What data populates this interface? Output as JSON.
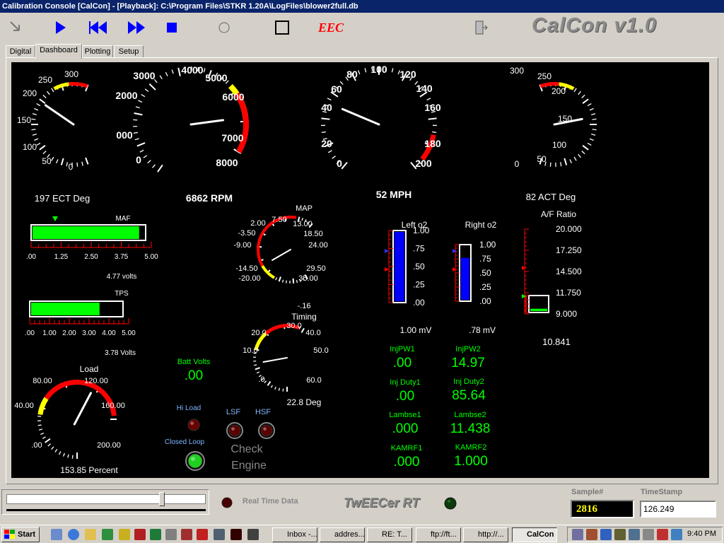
{
  "window": {
    "title": "Calibration Console [CalCon] - [Playback]: C:\\Program Files\\STKR 1.20A\\LogFiles\\blower2full.db"
  },
  "toolbar": {
    "brand": "CalCon v1.0",
    "eec_icon": "EEC"
  },
  "tabs": [
    {
      "label": "Digital"
    },
    {
      "label": "Dashboard"
    },
    {
      "label": "Plotting"
    },
    {
      "label": "Setup"
    }
  ],
  "gauges": {
    "ect": {
      "ticks": [
        "300",
        "250",
        "200",
        "150",
        "100",
        "50",
        "0"
      ],
      "readout": "197 ECT Deg",
      "value": 197
    },
    "rpm": {
      "ticks": [
        "8000",
        "7000",
        "6000",
        "5000",
        "4000",
        "3000",
        "2000",
        "000",
        "0"
      ],
      "readout": "6862 RPM",
      "value": 6862
    },
    "speed": {
      "ticks": [
        "0",
        "20",
        "40",
        "60",
        "80",
        "100",
        "120",
        "140",
        "160",
        "180",
        "200"
      ],
      "readout": "52 MPH",
      "value": 52
    },
    "act": {
      "ticks": [
        "300",
        "250",
        "200",
        "150",
        "100",
        "50",
        "0"
      ],
      "readout": "82 ACT Deg",
      "value": 82
    },
    "map": {
      "title": "MAP",
      "ticks": [
        "-20.00",
        "-14.50",
        "-9.00",
        "-3.50",
        "2.00",
        "7.50",
        "13.00",
        "18.50",
        "24.00",
        "29.50",
        "35.00"
      ],
      "value": -0.6
    },
    "timing": {
      "title": "Timing",
      "ticks": [
        ".0",
        "10.0",
        "20.0",
        "30.0",
        "40.0",
        "50.0",
        "60.0"
      ],
      "top_value": "-.16",
      "readout": "22.8 Deg",
      "value": 22.8
    },
    "load": {
      "title": "Load",
      "ticks": [
        ".00",
        "40.00",
        "80.00",
        "120.00",
        "160.00",
        "200.00"
      ],
      "readout": "153.85 Percent",
      "value": 153.85
    }
  },
  "bars": {
    "maf": {
      "title": "MAF",
      "ticks": [
        ".00",
        "1.25",
        "2.50",
        "3.75",
        "5.00"
      ],
      "readout": "4.77 volts",
      "value": 4.77,
      "max": 5.0
    },
    "tps": {
      "title": "TPS",
      "ticks": [
        ".00",
        "1.00",
        "2.00",
        "3.00",
        "4.00",
        "5.00"
      ],
      "readout": "3.78 Volts",
      "value": 3.78,
      "max": 5.0
    },
    "left_o2": {
      "title": "Left o2",
      "ticks": [
        "1.00",
        ".75",
        ".50",
        ".25",
        ".00"
      ],
      "readout": "1.00 mV",
      "value": 1.0,
      "max": 1.0
    },
    "right_o2": {
      "title": "Right o2",
      "ticks": [
        "1.00",
        ".75",
        ".50",
        ".25",
        ".00"
      ],
      "readout": ".78 mV",
      "value": 0.78,
      "max": 1.0
    },
    "af": {
      "title": "A/F Ratio",
      "ticks": [
        "20.000",
        "17.250",
        "14.500",
        "11.750",
        "9.000"
      ],
      "readout": "10.841",
      "value": 10.841,
      "min": 9.0,
      "max": 20.0
    }
  },
  "digital": {
    "batt": {
      "label": "Batt Volts",
      "value": ".00"
    },
    "injpw1": {
      "label": "InjPW1",
      "value": ".00"
    },
    "injpw2": {
      "label": "InjPW2",
      "value": "14.97"
    },
    "injduty1": {
      "label": "Inj Duty1",
      "value": ".00"
    },
    "injduty2": {
      "label": "Inj Duty2",
      "value": "85.64"
    },
    "lambse1": {
      "label": "Lambse1",
      "value": ".000"
    },
    "lambse2": {
      "label": "Lambse2",
      "value": "11.438"
    },
    "kamrf1": {
      "label": "KAMRF1",
      "value": ".000"
    },
    "kamrf2": {
      "label": "KAMRF2",
      "value": "1.000"
    }
  },
  "lamps": {
    "hi_load": "Hi Load",
    "closed_loop": "Closed Loop",
    "lsf": "LSF",
    "hsf": "HSF",
    "check_engine": [
      "Check",
      "Engine"
    ]
  },
  "bottom": {
    "real_time": "Real Time Data",
    "logo": "TwEECer RT",
    "sample_label": "Sample#",
    "sample_value": "2816",
    "timestamp_label": "TimeStamp",
    "timestamp_value": "126.249",
    "playback_position": 0.79
  },
  "taskbar": {
    "start": "Start",
    "tasks": [
      "Inbox -...",
      "addres...",
      "RE: T...",
      "ftp://ft...",
      "http://...",
      "CalCon"
    ],
    "clock": "9:40 PM"
  },
  "colors": {
    "title_bar": "#0a246a",
    "dash_bg": "#000000",
    "green": "#00ff00",
    "bar_blue": "#0000ff",
    "gauge_red": "#ff0000",
    "gauge_yellow": "#ffff00",
    "digital_green": "#00ff00"
  }
}
